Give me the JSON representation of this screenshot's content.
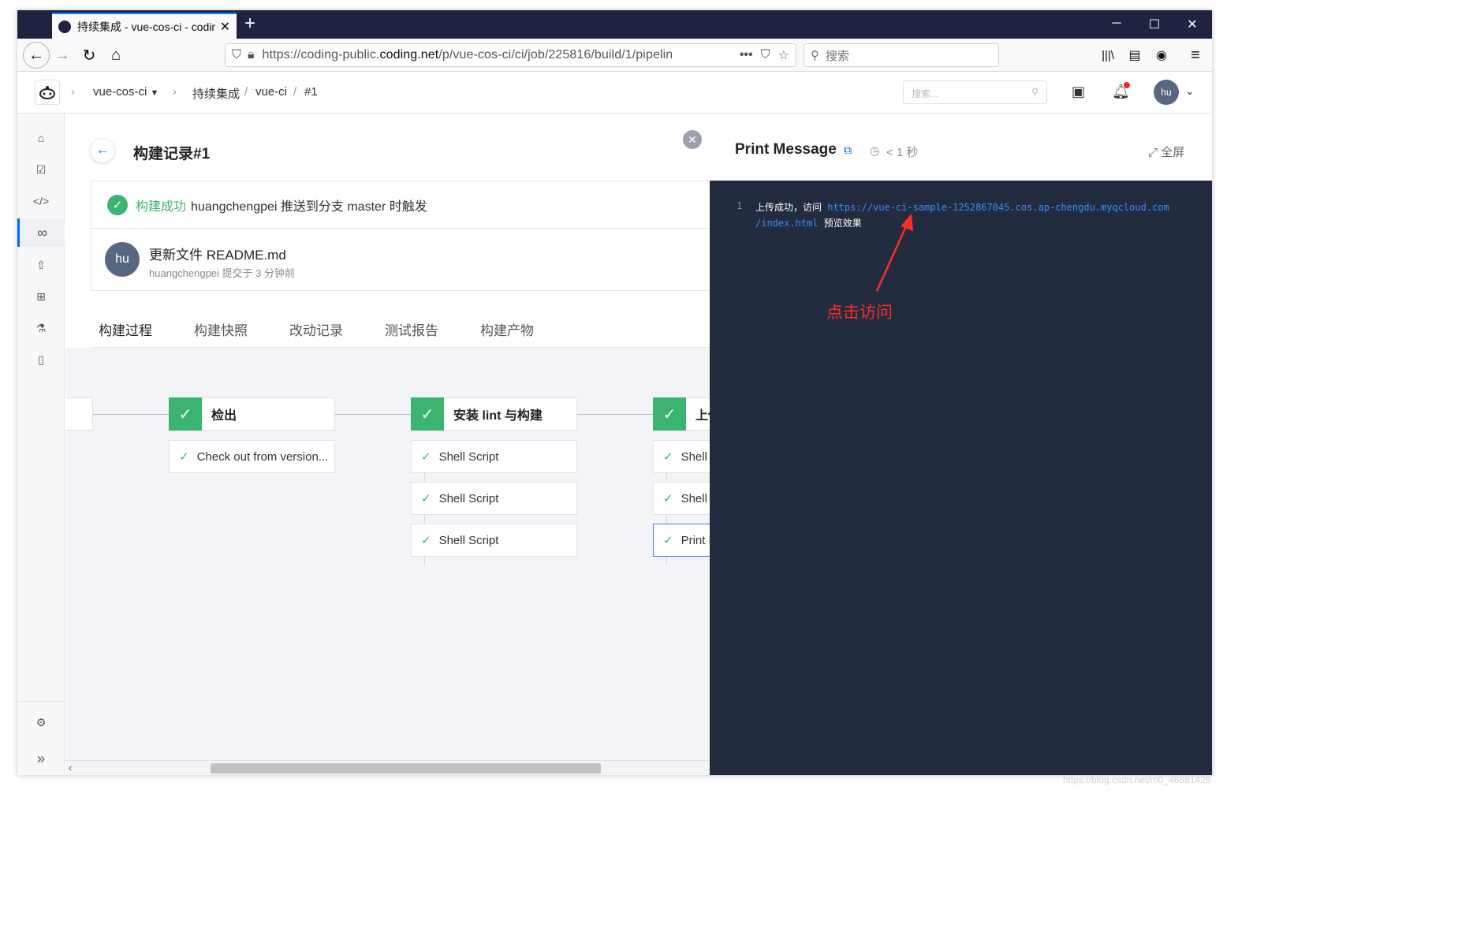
{
  "browser": {
    "tab_title": "持续集成 - vue-cos-ci - codin",
    "url_prefix": "https://coding-public.",
    "url_domain": "coding.net",
    "url_path": "/p/vue-cos-ci/ci/job/225816/build/1/pipelin",
    "search_placeholder": "搜索"
  },
  "header": {
    "project": "vue-cos-ci",
    "crumb_ci": "持续集成",
    "crumb_sep": "/",
    "crumb_job": "vue-ci",
    "crumb_build": "#1",
    "search_placeholder": "搜索...",
    "avatar_text": "hu"
  },
  "build": {
    "title": "构建记录#1",
    "status": "构建成功",
    "trigger_text": "huangchengpei 推送到分支 master 时触发",
    "commit_avatar": "hu",
    "commit_message": "更新文件 README.md",
    "commit_meta": "huangchengpei 提交于 3 分钟前"
  },
  "tabs": [
    "构建过程",
    "构建快照",
    "改动记录",
    "测试报告",
    "构建产物"
  ],
  "pipeline": {
    "stages": [
      {
        "name": "检出",
        "jobs": [
          "Check out from version..."
        ]
      },
      {
        "name": "安装 lint 与构建",
        "jobs": [
          "Shell Script",
          "Shell Script",
          "Shell Script"
        ]
      },
      {
        "name": "上传",
        "jobs": [
          "Shell Script",
          "Shell Script",
          "Print Message"
        ]
      }
    ]
  },
  "panel": {
    "title": "Print Message",
    "duration": "< 1 秒",
    "fullscreen": "全屏",
    "log_line_no": "1",
    "log_prefix": "上传成功，访问 ",
    "log_link_1": "https://vue-ci-sample-1252867045.cos.ap-chengdu.myqcloud.com",
    "log_link_2": "/index.html",
    "log_suffix": " 预览效果"
  },
  "annotation": "点击访问",
  "watermark": "https://blog.csdn.net/m0_46881428",
  "colors": {
    "accent": "#0066ff",
    "success": "#3bb46f",
    "panel_bg": "#232c3f",
    "annotation": "#ff2b2b"
  }
}
